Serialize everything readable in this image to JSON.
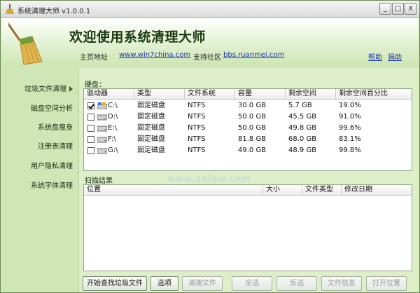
{
  "window": {
    "title": "系统清理大师 v1.0.0.1",
    "controls": {
      "minimize": "_",
      "maximize": "□",
      "close": "X"
    }
  },
  "header": {
    "welcome": "欢迎使用系统清理大师",
    "home_label": "主页地址",
    "home_url": "www.win7china.com",
    "forum_label": "支持社区",
    "forum_url": "bbs.ruanmei.com",
    "help": "帮助",
    "donate": "捐助"
  },
  "sidebar": {
    "items": [
      {
        "label": "垃圾文件清理",
        "active": true
      },
      {
        "label": "磁盘空间分析",
        "active": false
      },
      {
        "label": "系统盘瘦身",
        "active": false
      },
      {
        "label": "注册表清理",
        "active": false
      },
      {
        "label": "用户隐私清理",
        "active": false
      },
      {
        "label": "系统字体清理",
        "active": false
      }
    ]
  },
  "disks": {
    "label": "硬盘：",
    "columns": [
      "驱动器",
      "类型",
      "文件系统",
      "容量",
      "剩余空间",
      "剩余空间百分比"
    ],
    "rows": [
      {
        "checked": true,
        "drive": "C:\\",
        "type": "固定磁盘",
        "fs": "NTFS",
        "capacity": "30.0 GB",
        "free": "5.7 GB",
        "percent": "19.0%",
        "system": true
      },
      {
        "checked": false,
        "drive": "D:\\",
        "type": "固定磁盘",
        "fs": "NTFS",
        "capacity": "50.0 GB",
        "free": "45.5 GB",
        "percent": "91.0%",
        "system": false
      },
      {
        "checked": false,
        "drive": "E:\\",
        "type": "固定磁盘",
        "fs": "NTFS",
        "capacity": "50.0 GB",
        "free": "49.8 GB",
        "percent": "99.6%",
        "system": false
      },
      {
        "checked": false,
        "drive": "F:\\",
        "type": "固定磁盘",
        "fs": "NTFS",
        "capacity": "81.8 GB",
        "free": "68.0 GB",
        "percent": "83.1%",
        "system": false
      },
      {
        "checked": false,
        "drive": "G:\\",
        "type": "固定磁盘",
        "fs": "NTFS",
        "capacity": "49.0 GB",
        "free": "48.9 GB",
        "percent": "99.8%",
        "system": false
      }
    ]
  },
  "results": {
    "label": "扫描结果",
    "columns": [
      "位置",
      "大小",
      "文件类型",
      "修改日期"
    ]
  },
  "watermark": "www.sxiaw.com",
  "buttons": [
    {
      "id": "start-scan",
      "label": "开始查找垃圾文件",
      "enabled": true
    },
    {
      "id": "options",
      "label": "选项",
      "enabled": true
    },
    {
      "id": "clean-files",
      "label": "清理文件",
      "enabled": false
    },
    {
      "id": "select-all",
      "label": "全选",
      "enabled": false
    },
    {
      "id": "invert-select",
      "label": "反选",
      "enabled": false
    },
    {
      "id": "file-info",
      "label": "文件信息",
      "enabled": false
    },
    {
      "id": "open-location",
      "label": "打开位置",
      "enabled": false
    }
  ],
  "colors": {
    "accent": "#cfe6b6",
    "link": "#1a3aa8",
    "title": "#1d3a12"
  }
}
